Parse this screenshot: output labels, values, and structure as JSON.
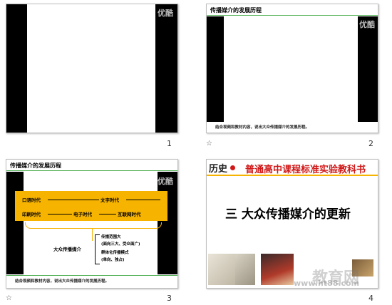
{
  "slides": [
    {
      "number": "1",
      "logo": "优酷"
    },
    {
      "number": "2",
      "title": "传播媒介的发展历程",
      "logo": "优酷",
      "caption": "结合视频和教材内容，说出大众传播媒介的发展历程。"
    },
    {
      "number": "3",
      "title": "传播媒介的发展历程",
      "logo": "优酷",
      "eras_row1": [
        "口语时代",
        "文字时代"
      ],
      "eras_row2": [
        "印刷时代",
        "电子时代",
        "互联网时代"
      ],
      "mass_media_label": "大众传播媒介",
      "bracket_lines": [
        "传播范围大",
        "(面向三大、受众面广)",
        "群体化传播模式",
        "(单向、独占)"
      ],
      "caption": "结合视频和教材内容，说出大众传播媒介的发展历程。"
    },
    {
      "number": "4",
      "subject": "历史",
      "series_title": "普通高中课程标准实验教科书",
      "main_title": "三 大众传播媒介的更新",
      "watermark_text": "教育网",
      "watermark_url": "www.ht88.com"
    }
  ],
  "colors": {
    "accent_orange": "#f6b300",
    "title_red": "#d01818"
  }
}
